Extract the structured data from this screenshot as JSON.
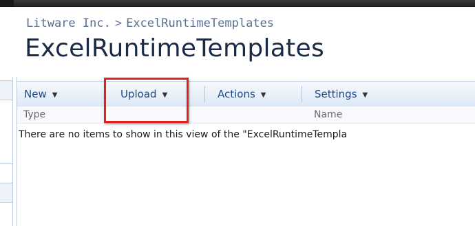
{
  "breadcrumb": {
    "site": "Litware Inc.",
    "separator": ">",
    "current": "ExcelRuntimeTemplates"
  },
  "page_title": "ExcelRuntimeTemplates",
  "toolbar": {
    "new_label": "New",
    "upload_label": "Upload",
    "actions_label": "Actions",
    "settings_label": "Settings"
  },
  "columns": {
    "type": "Type",
    "name": "Name"
  },
  "empty_message": "There are no items to show in this view of the \"ExcelRuntimeTempla",
  "colors": {
    "highlight": "#e0201b",
    "toolbar_text": "#1d4a8c",
    "title_text": "#1b2a44"
  }
}
